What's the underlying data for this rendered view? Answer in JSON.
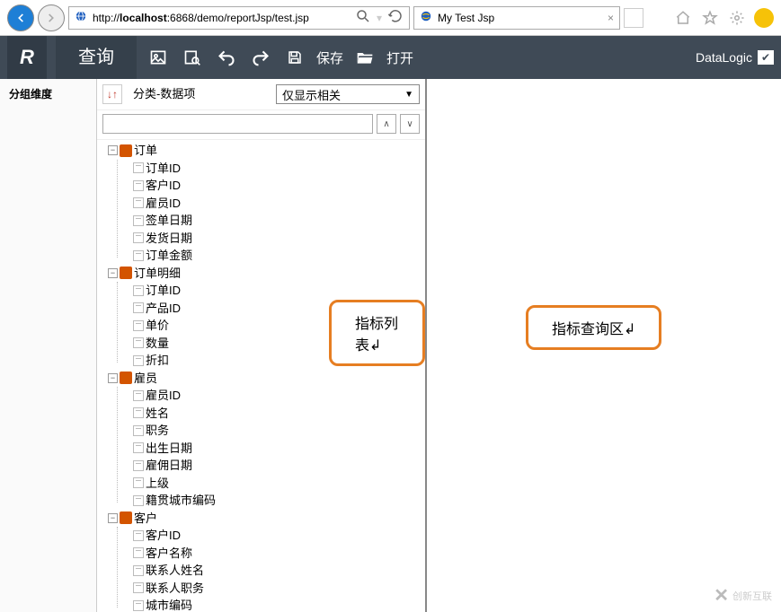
{
  "browser": {
    "url_prefix": "http://",
    "url_host": "localhost",
    "url_rest": ":6868/demo/reportJsp/test.jsp",
    "tab_title": "My Test Jsp"
  },
  "toolbar": {
    "query": "查询",
    "save": "保存",
    "open": "打开",
    "brand": "DataLogic"
  },
  "leftPane": {
    "title": "分组维度"
  },
  "midPane": {
    "category_label": "分类-数据项",
    "related_only": "仅显示相关"
  },
  "tree": [
    {
      "name": "订单",
      "children": [
        "订单ID",
        "客户ID",
        "雇员ID",
        "签单日期",
        "发货日期",
        "订单金额"
      ]
    },
    {
      "name": "订单明细",
      "children": [
        "订单ID",
        "产品ID",
        "单价",
        "数量",
        "折扣"
      ]
    },
    {
      "name": "雇员",
      "children": [
        "雇员ID",
        "姓名",
        "职务",
        "出生日期",
        "雇佣日期",
        "上级",
        "籍贯城市编码"
      ]
    },
    {
      "name": "客户",
      "children": [
        "客户ID",
        "客户名称",
        "联系人姓名",
        "联系人职务",
        "城市编码"
      ]
    }
  ],
  "callouts": {
    "mid": "指标列表",
    "right": "指标查询区"
  },
  "watermark": "创新互联"
}
